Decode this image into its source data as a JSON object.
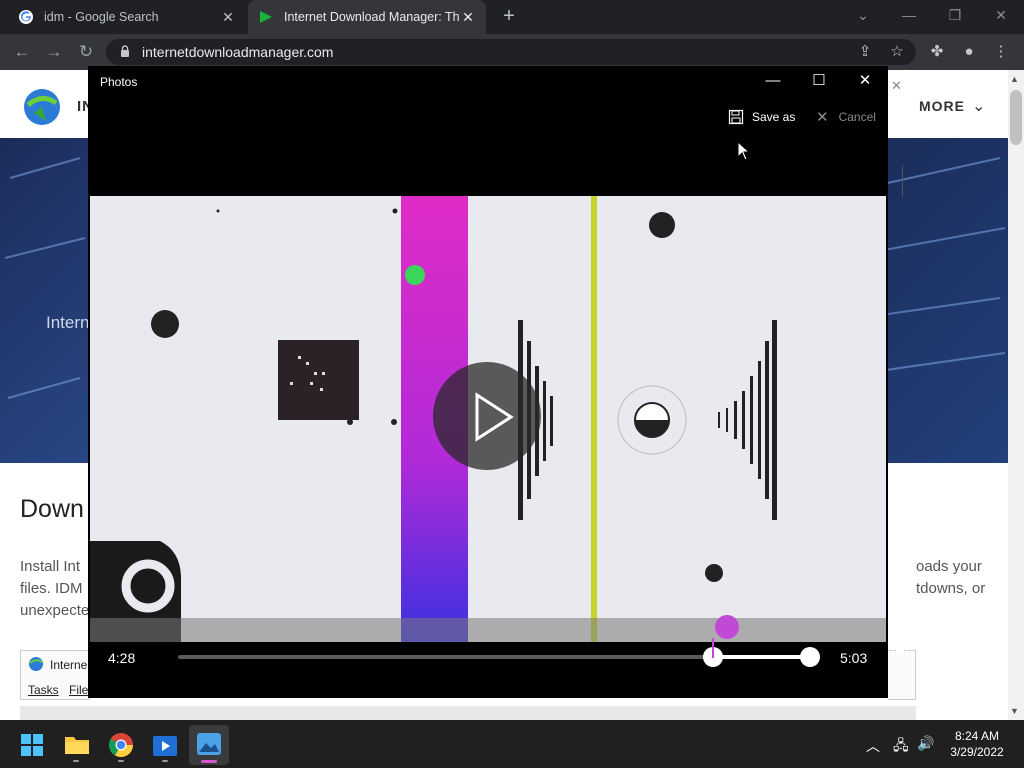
{
  "browser": {
    "tabs": [
      {
        "title": "idm - Google Search",
        "active": false
      },
      {
        "title": "Internet Download Manager: The",
        "active": true
      }
    ],
    "url": "internetdownloadmanager.com",
    "new_tab": "+"
  },
  "website": {
    "nav_more": "MORE",
    "nav_brand_partial": "IN",
    "hero_text_partial": "Intern",
    "heading_partial": "Down",
    "paragraph_left": [
      "Install Int",
      "files. IDM",
      "unexpecte"
    ],
    "paragraph_right": [
      "oads your",
      "tdowns, or"
    ],
    "window_title_partial": "Interne",
    "menu_items": [
      "Tasks",
      "File"
    ]
  },
  "photos": {
    "title": "Photos",
    "save_as": "Save as",
    "cancel": "Cancel",
    "current_time": "4:28",
    "total_time": "5:03",
    "trim_start_fraction": 0.0,
    "playhead_fraction": 0.846,
    "trim_end_fraction": 1.0
  },
  "taskbar": {
    "apps": [
      "start-icon",
      "file-explorer-icon",
      "chrome-icon",
      "video-editor-icon",
      "photos-icon"
    ],
    "time": "8:24 AM",
    "date": "3/29/2022"
  },
  "colors": {
    "chrome_dark": "#202124",
    "chrome_toolbar": "#35363a",
    "magenta_bar": "#d62fcf",
    "yellow_line": "#c8d42a",
    "green_dot": "#3ad65a"
  }
}
